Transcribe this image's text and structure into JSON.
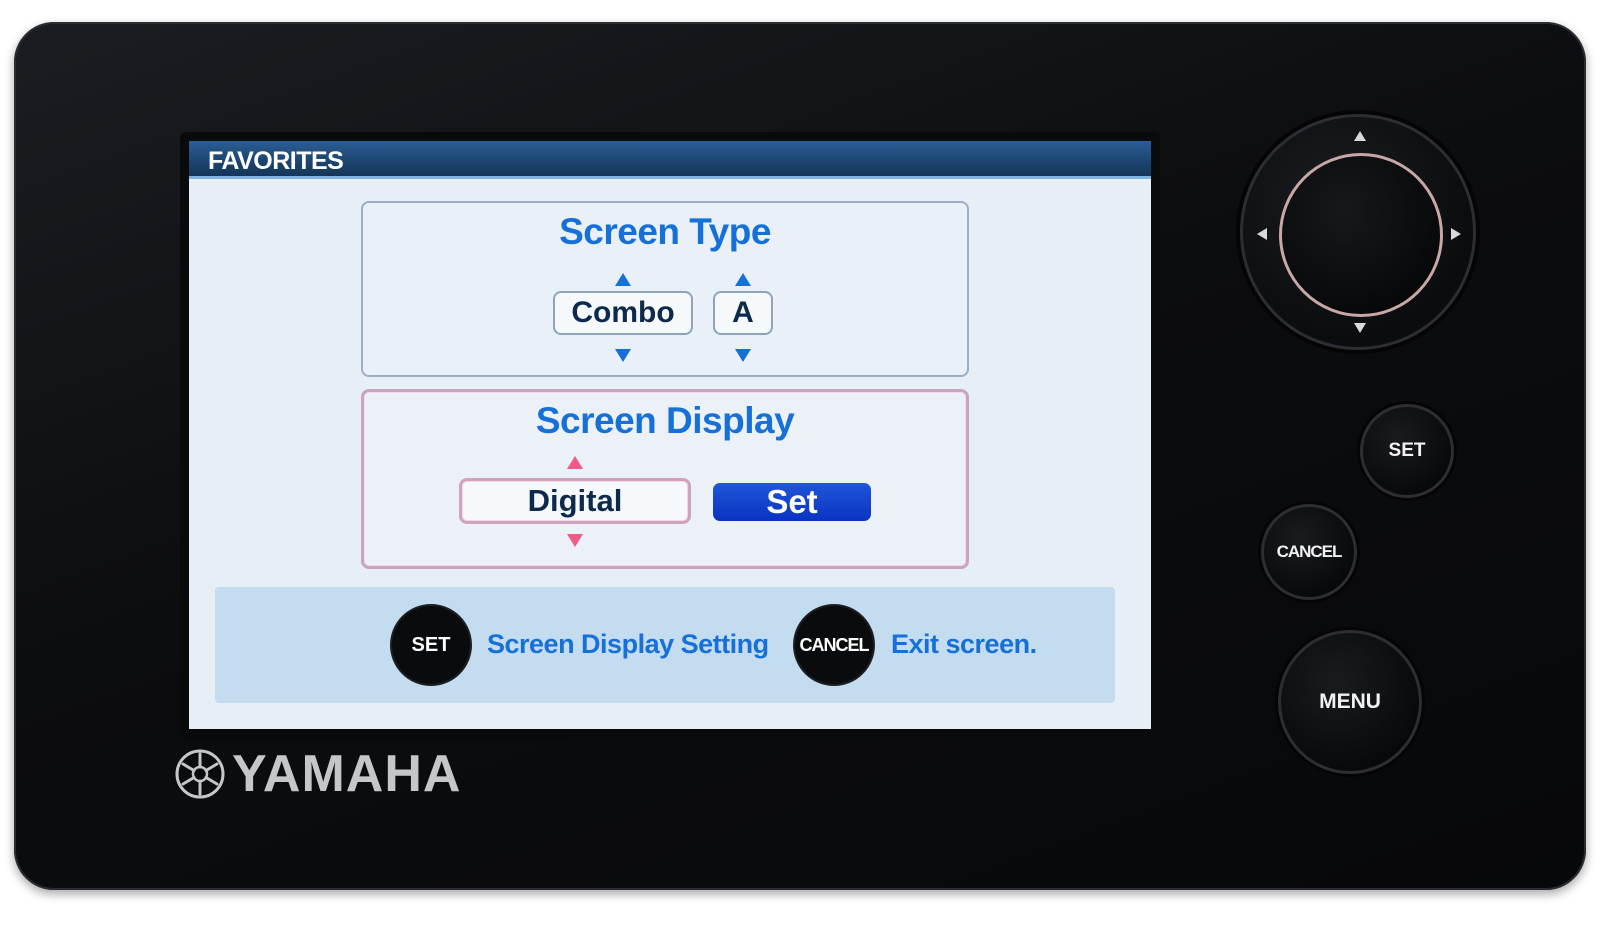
{
  "screen": {
    "title": "FAVORITES",
    "screen_type": {
      "heading": "Screen Type",
      "mode_value": "Combo",
      "variant_value": "A"
    },
    "screen_display": {
      "heading": "Screen Display",
      "display_value": "Digital",
      "set_label": "Set"
    },
    "help": {
      "set_key": "SET",
      "set_text": "Screen Display Setting",
      "cancel_key": "CANCEL",
      "cancel_text": "Exit screen."
    }
  },
  "hardware": {
    "set_label": "SET",
    "cancel_label": "CANCEL",
    "menu_label": "MENU"
  },
  "brand": {
    "name": "YAMAHA"
  },
  "colors": {
    "accent_blue": "#1670d8",
    "highlight_pink": "#ef5b84",
    "button_blue": "#0a33c2",
    "screen_bg": "#e6eef6"
  }
}
